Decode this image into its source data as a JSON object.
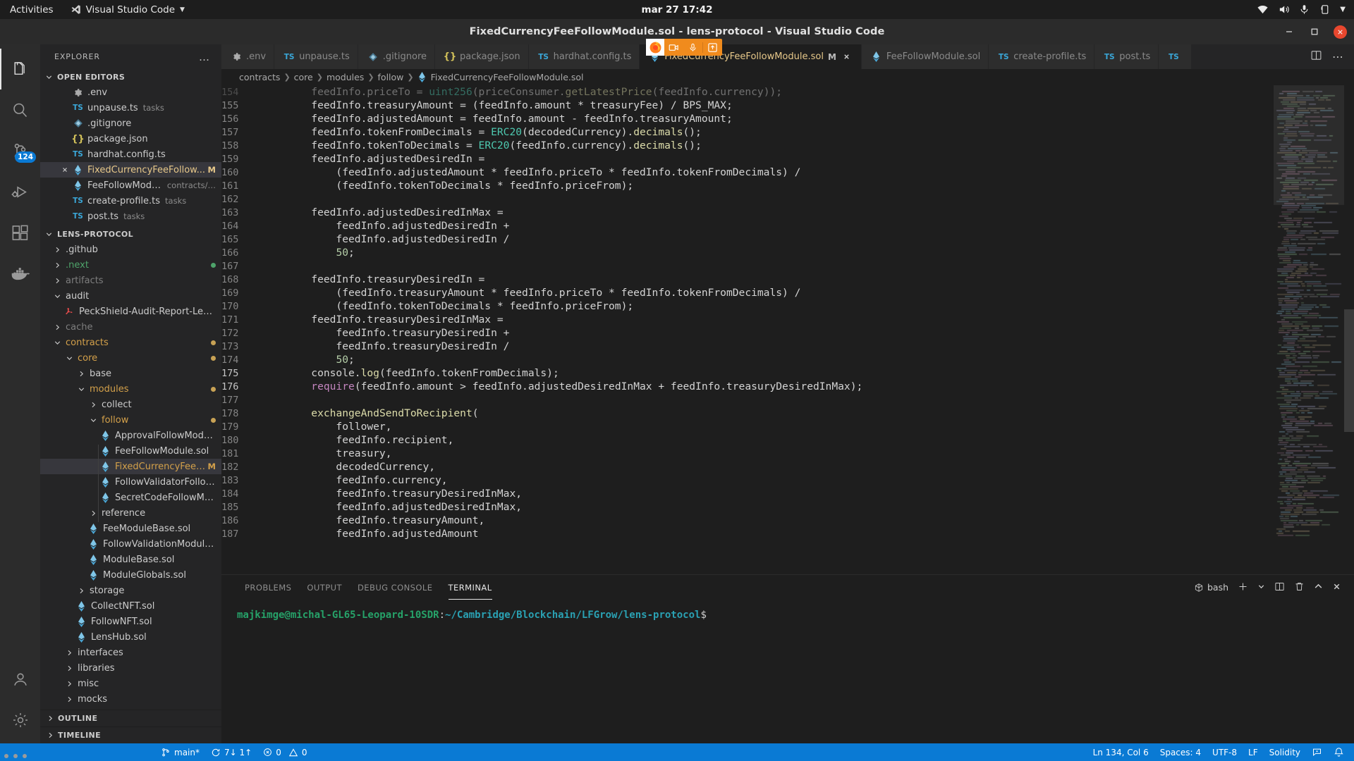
{
  "gnome": {
    "activities": "Activities",
    "app_name": "Visual Studio Code",
    "clock": "mar 27  17:42",
    "tray_icons": [
      "wifi-icon",
      "volume-icon",
      "microphone-icon",
      "battery-icon",
      "chevron-down-icon"
    ]
  },
  "window": {
    "title": "FixedCurrencyFeeFollowModule.sol - lens-protocol - Visual Studio Code",
    "minimize_label": "Minimize",
    "maximize_label": "Maximize",
    "close_label": "Close"
  },
  "share_overlay": {
    "icons": [
      "firefox-icon",
      "screen-share-icon",
      "microphone-icon",
      "window-share-icon"
    ]
  },
  "activitybar": {
    "items": [
      {
        "name": "explorer",
        "icon": "files-icon",
        "active": true,
        "badge": ""
      },
      {
        "name": "search",
        "icon": "search-icon",
        "active": false,
        "badge": ""
      },
      {
        "name": "source-control",
        "icon": "source-control-icon",
        "active": false,
        "badge": "124"
      },
      {
        "name": "run-and-debug",
        "icon": "run-debug-icon",
        "active": false,
        "badge": ""
      },
      {
        "name": "extensions",
        "icon": "extensions-icon",
        "active": false,
        "badge": ""
      },
      {
        "name": "docker",
        "icon": "docker-icon",
        "active": false,
        "badge": ""
      }
    ],
    "bottom": [
      {
        "name": "accounts",
        "icon": "account-icon"
      },
      {
        "name": "manage",
        "icon": "gear-icon"
      }
    ]
  },
  "sidebar": {
    "header": "EXPLORER",
    "header_more": "…",
    "open_editors": {
      "label": "OPEN EDITORS",
      "items": [
        {
          "name": ".env",
          "icon": "gear-file-icon",
          "desc": "",
          "badge": "",
          "selected": false,
          "close": false
        },
        {
          "name": "unpause.ts",
          "icon": "ts-icon",
          "desc": "tasks",
          "badge": "",
          "selected": false,
          "close": false
        },
        {
          "name": ".gitignore",
          "icon": "git-icon",
          "desc": "",
          "badge": "",
          "selected": false,
          "close": false
        },
        {
          "name": "package.json",
          "icon": "json-icon",
          "desc": "",
          "badge": "",
          "selected": false,
          "close": false
        },
        {
          "name": "hardhat.config.ts",
          "icon": "ts-icon",
          "desc": "",
          "badge": "",
          "selected": false,
          "close": false
        },
        {
          "name": "FixedCurrencyFeeFollow...",
          "icon": "sol-icon",
          "desc": "",
          "badge": "M",
          "selected": true,
          "close": true
        },
        {
          "name": "FeeFollowModule.sol",
          "icon": "sol-icon",
          "desc": "contracts/…",
          "badge": "",
          "selected": false,
          "close": false
        },
        {
          "name": "create-profile.ts",
          "icon": "ts-icon",
          "desc": "tasks",
          "badge": "",
          "selected": false,
          "close": false
        },
        {
          "name": "post.ts",
          "icon": "ts-icon",
          "desc": "tasks",
          "badge": "",
          "selected": false,
          "close": false
        }
      ]
    },
    "project": {
      "label": "LENS-PROTOCOL",
      "tree": [
        {
          "name": ".github",
          "type": "folder",
          "open": false,
          "depth": 1,
          "dot": ""
        },
        {
          "name": ".next",
          "type": "folder",
          "open": false,
          "depth": 1,
          "dot": "#4ea36a",
          "color": "#4ea36a"
        },
        {
          "name": "artifacts",
          "type": "folder",
          "open": false,
          "depth": 1,
          "dot": "",
          "color": "#7e7e7e"
        },
        {
          "name": "audit",
          "type": "folder",
          "open": true,
          "depth": 1,
          "dot": ""
        },
        {
          "name": "PeckShield-Audit-Report-LensProto…",
          "type": "pdf",
          "depth": 2,
          "dot": ""
        },
        {
          "name": "cache",
          "type": "folder",
          "open": false,
          "depth": 1,
          "dot": "",
          "color": "#7e7e7e"
        },
        {
          "name": "contracts",
          "type": "folder",
          "open": true,
          "depth": 1,
          "dot": "#c8a255",
          "color": "#d3a04a"
        },
        {
          "name": "core",
          "type": "folder",
          "open": true,
          "depth": 2,
          "dot": "#c8a255",
          "color": "#d3a04a"
        },
        {
          "name": "base",
          "type": "folder",
          "open": false,
          "depth": 3,
          "dot": ""
        },
        {
          "name": "modules",
          "type": "folder",
          "open": true,
          "depth": 3,
          "dot": "#c8a255",
          "color": "#d3a04a"
        },
        {
          "name": "collect",
          "type": "folder",
          "open": false,
          "depth": 4,
          "dot": ""
        },
        {
          "name": "follow",
          "type": "folder",
          "open": true,
          "depth": 4,
          "dot": "#c8a255",
          "color": "#d3a04a"
        },
        {
          "name": "ApprovalFollowModule.sol",
          "type": "sol",
          "depth": 5,
          "dot": ""
        },
        {
          "name": "FeeFollowModule.sol",
          "type": "sol",
          "depth": 5,
          "dot": ""
        },
        {
          "name": "FixedCurrencyFeeFollow…",
          "type": "sol",
          "depth": 5,
          "badge": "M",
          "selected": true,
          "color": "#d3a04a"
        },
        {
          "name": "FollowValidatorFollowModule…",
          "type": "sol",
          "depth": 5,
          "dot": ""
        },
        {
          "name": "SecretCodeFollowModule.sol",
          "type": "sol",
          "depth": 5,
          "dot": ""
        },
        {
          "name": "reference",
          "type": "folder",
          "open": false,
          "depth": 4,
          "dot": ""
        },
        {
          "name": "FeeModuleBase.sol",
          "type": "sol",
          "depth": 4,
          "dot": ""
        },
        {
          "name": "FollowValidationModuleBase.sol",
          "type": "sol",
          "depth": 4,
          "dot": ""
        },
        {
          "name": "ModuleBase.sol",
          "type": "sol",
          "depth": 4,
          "dot": ""
        },
        {
          "name": "ModuleGlobals.sol",
          "type": "sol",
          "depth": 4,
          "dot": ""
        },
        {
          "name": "storage",
          "type": "folder",
          "open": false,
          "depth": 3,
          "dot": ""
        },
        {
          "name": "CollectNFT.sol",
          "type": "sol",
          "depth": 3,
          "dot": ""
        },
        {
          "name": "FollowNFT.sol",
          "type": "sol",
          "depth": 3,
          "dot": ""
        },
        {
          "name": "LensHub.sol",
          "type": "sol",
          "depth": 3,
          "dot": ""
        },
        {
          "name": "interfaces",
          "type": "folder",
          "open": false,
          "depth": 2,
          "dot": ""
        },
        {
          "name": "libraries",
          "type": "folder",
          "open": false,
          "depth": 2,
          "dot": ""
        },
        {
          "name": "misc",
          "type": "folder",
          "open": false,
          "depth": 2,
          "dot": ""
        },
        {
          "name": "mocks",
          "type": "folder",
          "open": false,
          "depth": 2,
          "dot": ""
        }
      ]
    },
    "outline": "OUTLINE",
    "timeline": "TIMELINE"
  },
  "tabs": [
    {
      "label": ".env",
      "icon": "gear-file-icon",
      "active": false,
      "dirty": "",
      "close": false
    },
    {
      "label": "unpause.ts",
      "icon": "ts-icon",
      "active": false,
      "dirty": "",
      "close": false
    },
    {
      "label": ".gitignore",
      "icon": "git-icon",
      "active": false,
      "dirty": "",
      "close": false
    },
    {
      "label": "package.json",
      "icon": "json-icon",
      "active": false,
      "dirty": "",
      "close": false
    },
    {
      "label": "hardhat.config.ts",
      "icon": "ts-icon",
      "active": false,
      "dirty": "",
      "close": false
    },
    {
      "label": "FixedCurrencyFeeFollowModule.sol",
      "icon": "sol-icon",
      "active": true,
      "dirty": "M",
      "close": true
    },
    {
      "label": "FeeFollowModule.sol",
      "icon": "sol-icon",
      "active": false,
      "dirty": "",
      "close": false
    },
    {
      "label": "create-profile.ts",
      "icon": "ts-icon",
      "active": false,
      "dirty": "",
      "close": false
    },
    {
      "label": "post.ts",
      "icon": "ts-icon",
      "active": false,
      "dirty": "",
      "close": false
    },
    {
      "label": "",
      "icon": "ts-icon",
      "active": false,
      "dirty": "",
      "close": false
    }
  ],
  "tabbar_actions": [
    "split-editor-icon",
    "more-actions-icon"
  ],
  "breadcrumb": {
    "parts": [
      "contracts",
      "core",
      "modules",
      "follow"
    ],
    "file": "FixedCurrencyFeeFollowModule.sol"
  },
  "editor": {
    "first_line": 154,
    "cursor_lines": [
      175,
      176
    ],
    "lines": [
      {
        "n": 154,
        "text": "        feedInfo.priceTo = uint256(priceConsumer.getLatestPrice(feedInfo.currency));",
        "clipped": true
      },
      {
        "n": 155,
        "text": "        feedInfo.treasuryAmount = (feedInfo.amount * treasuryFee) / BPS_MAX;"
      },
      {
        "n": 156,
        "text": "        feedInfo.adjustedAmount = feedInfo.amount - feedInfo.treasuryAmount;"
      },
      {
        "n": 157,
        "text": "        feedInfo.tokenFromDecimals = ERC20(decodedCurrency).decimals();"
      },
      {
        "n": 158,
        "text": "        feedInfo.tokenToDecimals = ERC20(feedInfo.currency).decimals();"
      },
      {
        "n": 159,
        "text": "        feedInfo.adjustedDesiredIn ="
      },
      {
        "n": 160,
        "text": "            (feedInfo.adjustedAmount * feedInfo.priceTo * feedInfo.tokenFromDecimals) /"
      },
      {
        "n": 161,
        "text": "            (feedInfo.tokenToDecimals * feedInfo.priceFrom);"
      },
      {
        "n": 162,
        "text": ""
      },
      {
        "n": 163,
        "text": "        feedInfo.adjustedDesiredInMax ="
      },
      {
        "n": 164,
        "text": "            feedInfo.adjustedDesiredIn +"
      },
      {
        "n": 165,
        "text": "            feedInfo.adjustedDesiredIn /"
      },
      {
        "n": 166,
        "text": "            50;"
      },
      {
        "n": 167,
        "text": ""
      },
      {
        "n": 168,
        "text": "        feedInfo.treasuryDesiredIn ="
      },
      {
        "n": 169,
        "text": "            (feedInfo.treasuryAmount * feedInfo.priceTo * feedInfo.tokenFromDecimals) /"
      },
      {
        "n": 170,
        "text": "            (feedInfo.tokenToDecimals * feedInfo.priceFrom);"
      },
      {
        "n": 171,
        "text": "        feedInfo.treasuryDesiredInMax ="
      },
      {
        "n": 172,
        "text": "            feedInfo.treasuryDesiredIn +"
      },
      {
        "n": 173,
        "text": "            feedInfo.treasuryDesiredIn /"
      },
      {
        "n": 174,
        "text": "            50;"
      },
      {
        "n": 175,
        "text": "        console.log(feedInfo.tokenFromDecimals);",
        "modified": true
      },
      {
        "n": 176,
        "text": "        require(feedInfo.amount > feedInfo.adjustedDesiredInMax + feedInfo.treasuryDesiredInMax);",
        "modified": true
      },
      {
        "n": 177,
        "text": ""
      },
      {
        "n": 178,
        "text": "        exchangeAndSendToRecipient("
      },
      {
        "n": 179,
        "text": "            follower,"
      },
      {
        "n": 180,
        "text": "            feedInfo.recipient,"
      },
      {
        "n": 181,
        "text": "            treasury,"
      },
      {
        "n": 182,
        "text": "            decodedCurrency,"
      },
      {
        "n": 183,
        "text": "            feedInfo.currency,"
      },
      {
        "n": 184,
        "text": "            feedInfo.treasuryDesiredInMax,"
      },
      {
        "n": 185,
        "text": "            feedInfo.adjustedDesiredInMax,"
      },
      {
        "n": 186,
        "text": "            feedInfo.treasuryAmount,"
      },
      {
        "n": 187,
        "text": "            feedInfo.adjustedAmount"
      }
    ]
  },
  "panel": {
    "tabs": [
      "PROBLEMS",
      "OUTPUT",
      "DEBUG CONSOLE",
      "TERMINAL"
    ],
    "active_tab": "TERMINAL",
    "shell_label": "bash",
    "actions": [
      "new-terminal-icon",
      "terminal-dropdown-icon",
      "split-terminal-icon",
      "kill-terminal-icon",
      "maximize-panel-icon",
      "close-panel-icon"
    ],
    "terminal": {
      "user_host": "majkimge@michal-GL65-Leopard-10SDR",
      "colon": ":",
      "path": "~/Cambridge/Blockchain/LFGrow/lens-protocol",
      "prompt": "$"
    }
  },
  "statusbar": {
    "branch": "main*",
    "sync": "7↓ 1↑",
    "errors": "0",
    "warnings": "0",
    "position": "Ln 134, Col 6",
    "indentation": "Spaces: 4",
    "encoding": "UTF-8",
    "eol": "LF",
    "language": "Solidity",
    "feedback_icon": "feedback-icon",
    "bell_icon": "bell-icon"
  },
  "colors": {
    "accent_blue": "#0a7ad4",
    "tab_active_fg": "#e7c88a",
    "editor_bg": "#1e1e1e",
    "sidebar_bg": "#252526",
    "modified_gutter": "#4e7a28"
  }
}
